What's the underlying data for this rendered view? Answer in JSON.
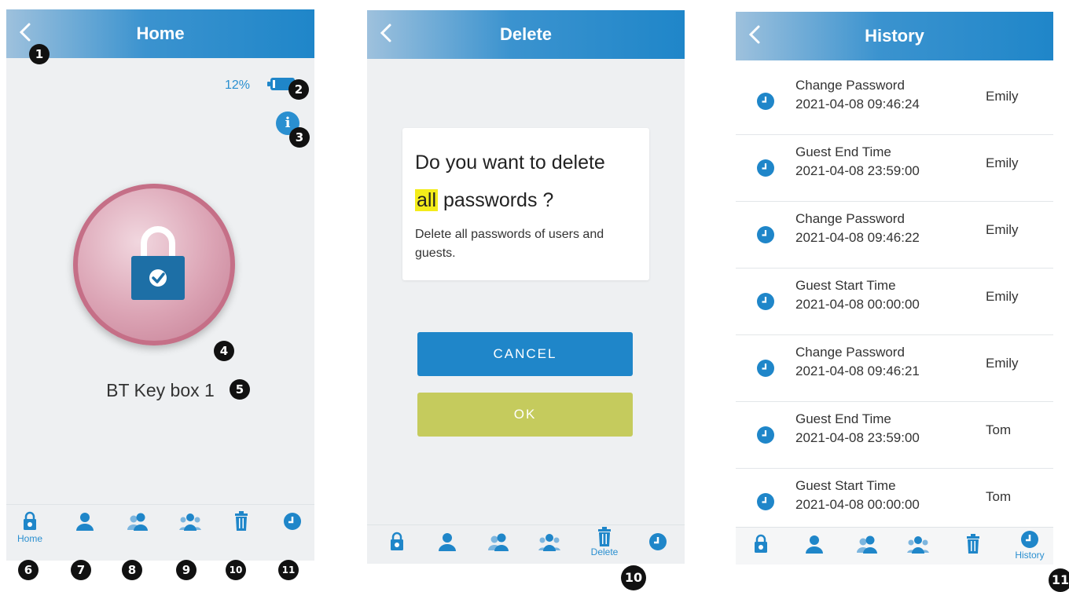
{
  "colors": {
    "accent": "#1f86c9",
    "ok": "#c5cb5d",
    "highlight": "#f3ec1a",
    "badge": "#111111"
  },
  "home": {
    "title": "Home",
    "battery_percent": "12%",
    "battery_level": 0.12,
    "info_label": "i",
    "device_name": "BT Key box 1",
    "tabs": {
      "home_label": "Home"
    }
  },
  "delete": {
    "title": "Delete",
    "question_line1": "Do you want to delete",
    "question_highlight": "all",
    "question_rest": " passwords ?",
    "description": "Delete all passwords of users and guests.",
    "cancel_label": "CANCEL",
    "ok_label": "OK",
    "tabs": {
      "delete_label": "Delete"
    }
  },
  "history": {
    "title": "History",
    "rows": [
      {
        "event": "Change Password",
        "time": "2021-04-08 09:46:24",
        "user": "Emily"
      },
      {
        "event": "Guest End Time",
        "time": "2021-04-08 23:59:00",
        "user": "Emily"
      },
      {
        "event": "Change Password",
        "time": "2021-04-08 09:46:22",
        "user": "Emily"
      },
      {
        "event": "Guest Start Time",
        "time": "2021-04-08 00:00:00",
        "user": "Emily"
      },
      {
        "event": "Change Password",
        "time": "2021-04-08 09:46:21",
        "user": "Emily"
      },
      {
        "event": "Guest End Time",
        "time": "2021-04-08 23:59:00",
        "user": "Tom"
      },
      {
        "event": "Guest Start Time",
        "time": "2021-04-08 00:00:00",
        "user": "Tom"
      }
    ],
    "tabs": {
      "history_label": "History"
    }
  },
  "callouts": {
    "back": "1",
    "battery": "2",
    "info": "3",
    "lock": "4",
    "name": "5",
    "tab_home": "6",
    "tab_user": "7",
    "tab_users": "8",
    "tab_guests": "9",
    "tab_delete": "10",
    "tab_history": "11",
    "delete_tab": "10",
    "history_tab": "11"
  }
}
